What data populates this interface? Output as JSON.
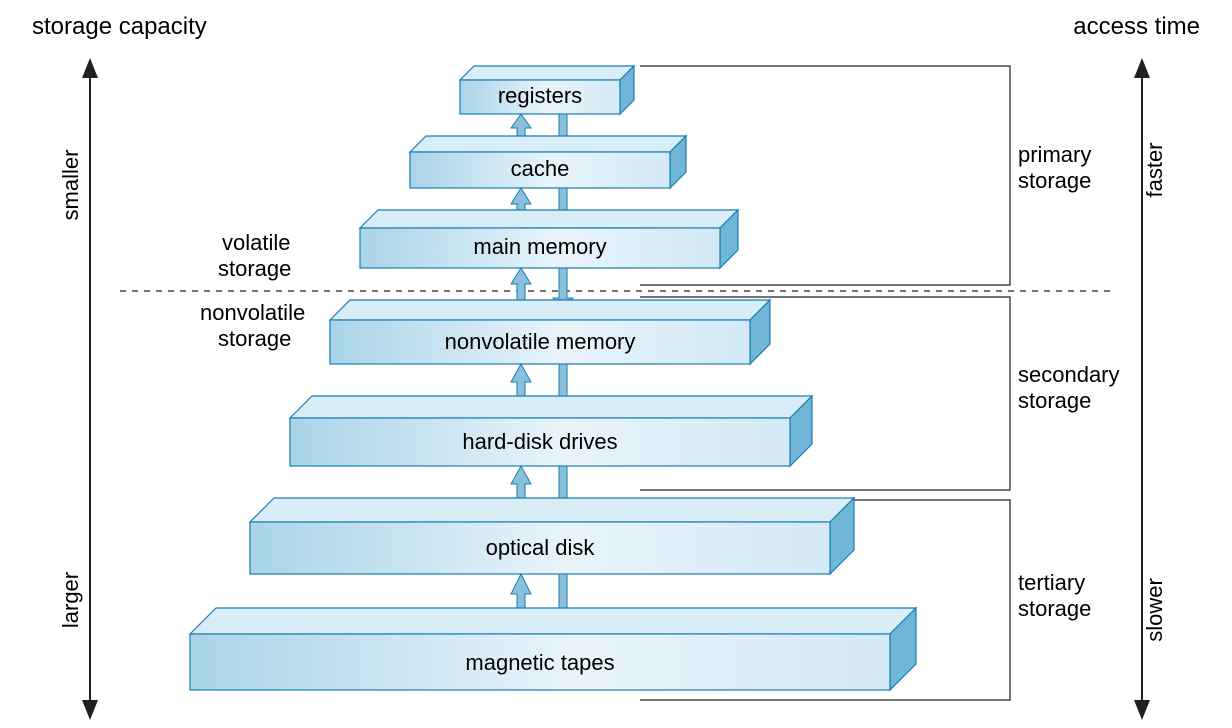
{
  "titles": {
    "left": "storage capacity",
    "right": "access time"
  },
  "axis": {
    "left_top": "smaller",
    "left_bottom": "larger",
    "right_top": "faster",
    "right_bottom": "slower"
  },
  "levels": [
    "registers",
    "cache",
    "main memory",
    "nonvolatile memory",
    "hard-disk drives",
    "optical disk",
    "magnetic tapes"
  ],
  "divider": {
    "above": "volatile\nstorage",
    "below": "nonvolatile\nstorage"
  },
  "groups": {
    "primary": "primary\nstorage",
    "secondary": "secondary\nstorage",
    "tertiary": "tertiary\nstorage"
  }
}
